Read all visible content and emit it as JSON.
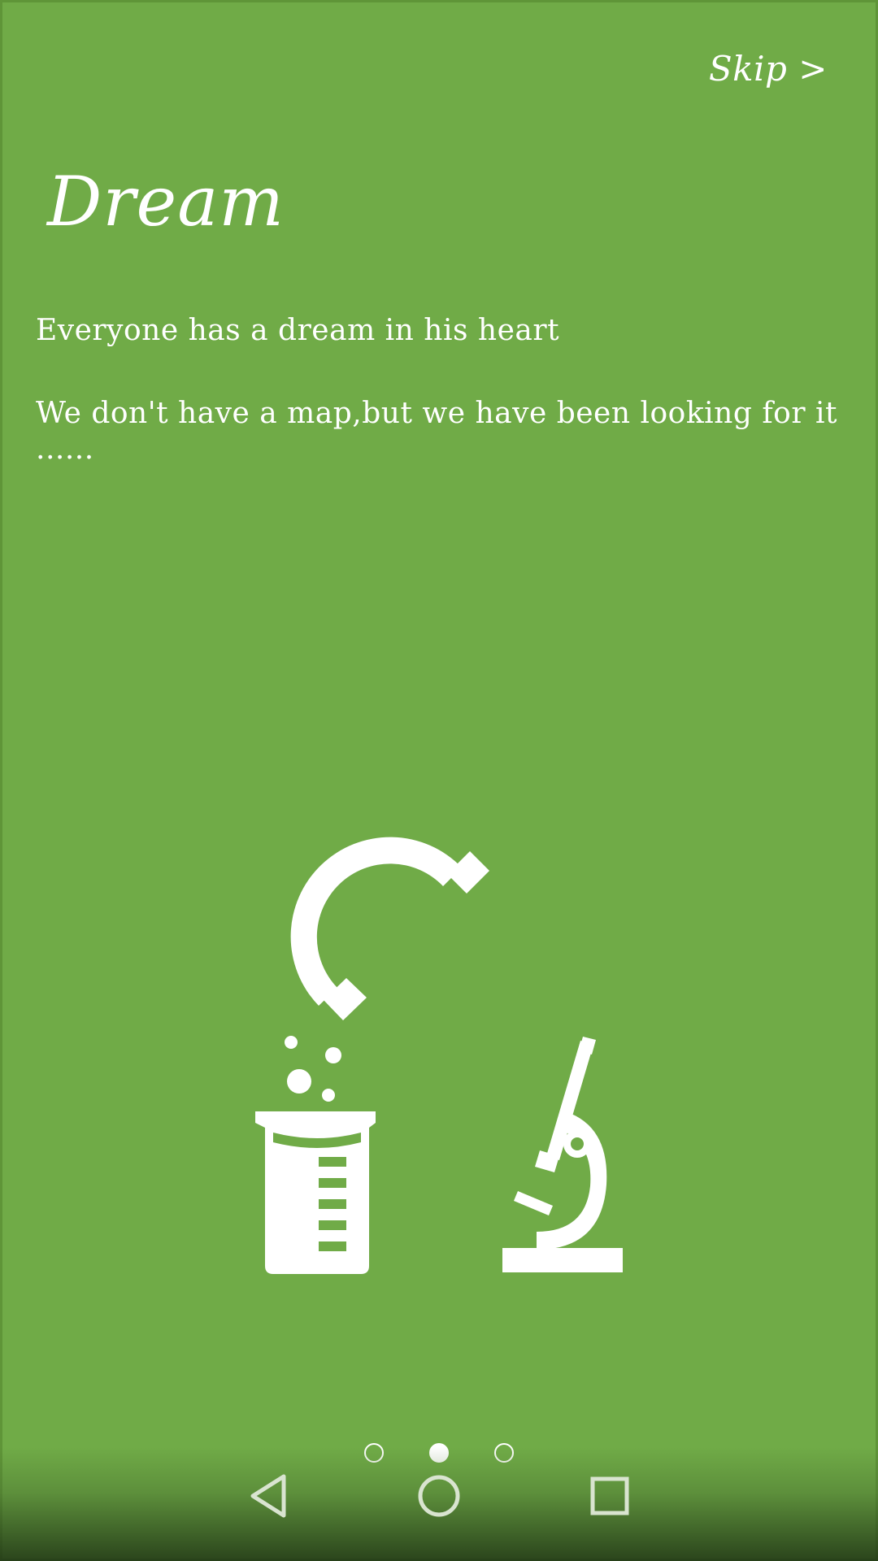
{
  "header": {
    "skip_label": "Skip >"
  },
  "content": {
    "title": "Dream",
    "lines": [
      "Everyone has a dream in his heart",
      "We don't have a map,but we have been looking for it ......"
    ]
  },
  "illustration": {
    "icons": [
      "magnet-icon",
      "beaker-icon",
      "microscope-icon"
    ]
  },
  "pager": {
    "count": 3,
    "active_index": 1
  },
  "navbar": {
    "icons": [
      "back-icon",
      "home-icon",
      "recents-icon"
    ]
  },
  "colors": {
    "background": "#70ab47",
    "foreground": "#ffffff"
  }
}
